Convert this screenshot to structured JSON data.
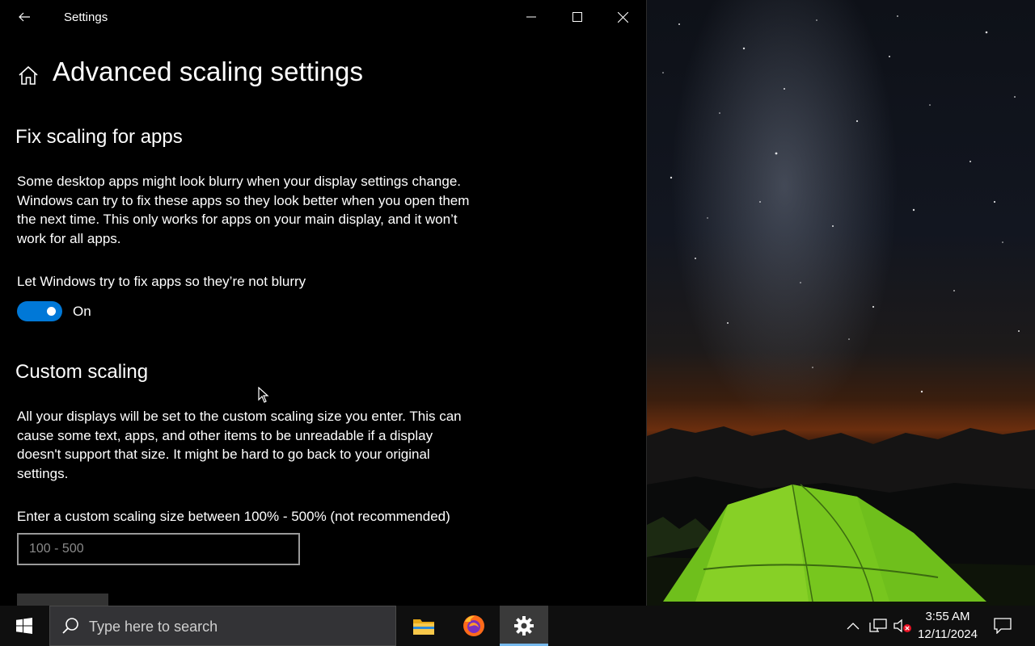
{
  "window": {
    "title": "Settings"
  },
  "page": {
    "title": "Advanced scaling settings"
  },
  "fix_scaling": {
    "heading": "Fix scaling for apps",
    "description": "Some desktop apps might look blurry when your display settings change. Windows can try to fix these apps so they look better when you open them the next time. This only works for apps on your main display, and it won’t work for all apps.",
    "toggle_label": "Let Windows try to fix apps so they’re not blurry",
    "toggle_state": "On",
    "toggle_on": true
  },
  "custom_scaling": {
    "heading": "Custom scaling",
    "description": "All your displays will be set to the custom scaling size you enter. This can cause some text, apps, and other items to be unreadable if a display doesn't support that size. It might be hard to go back to your original settings.",
    "input_label": "Enter a custom scaling size between 100% - 500% (not recommended)",
    "input_placeholder": "100 - 500",
    "input_value": ""
  },
  "taskbar": {
    "search_placeholder": "Type here to search",
    "apps": [
      "file-explorer",
      "firefox",
      "settings"
    ],
    "active_app": "settings",
    "time": "3:55 AM",
    "date": "12/11/2024"
  },
  "colors": {
    "accent": "#0078d7",
    "active_indicator": "#76b9ed",
    "window_bg": "#000000",
    "taskbar_bg": "#0f0f0f"
  }
}
